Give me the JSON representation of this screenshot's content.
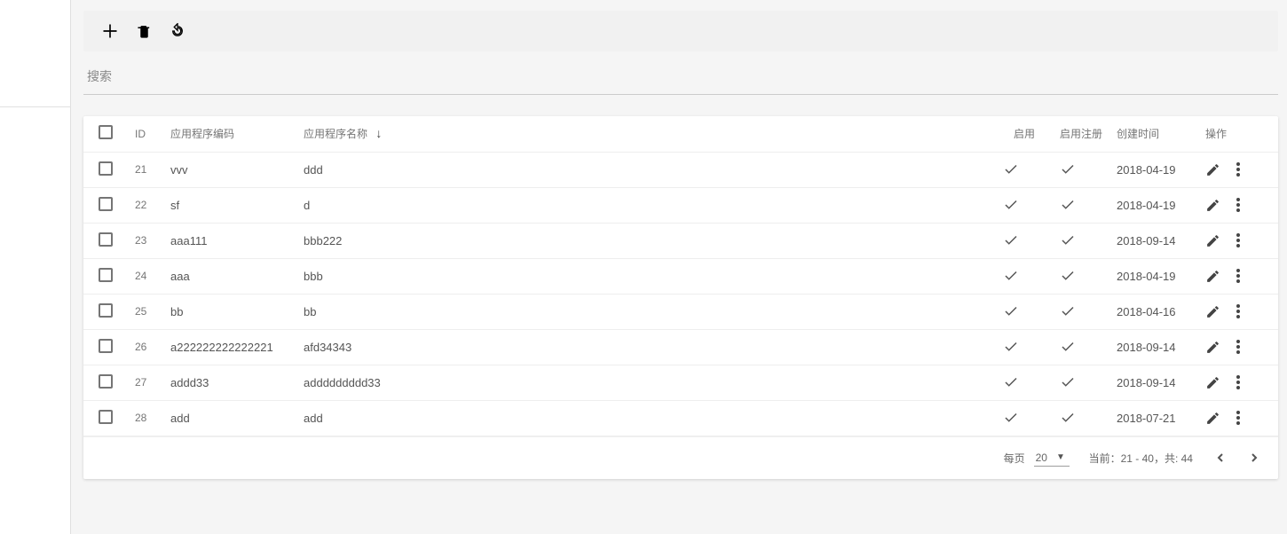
{
  "search": {
    "placeholder": "搜索"
  },
  "columns": {
    "id": "ID",
    "code": "应用程序编码",
    "name": "应用程序名称",
    "enable": "启用",
    "reg": "启用注册",
    "date": "创建时间",
    "action": "操作"
  },
  "rows": [
    {
      "id": "21",
      "code": "vvv",
      "name": "ddd",
      "enable": true,
      "reg": true,
      "date": "2018-04-19"
    },
    {
      "id": "22",
      "code": "sf",
      "name": "d",
      "enable": true,
      "reg": true,
      "date": "2018-04-19"
    },
    {
      "id": "23",
      "code": "aaa111",
      "name": "bbb222",
      "enable": true,
      "reg": true,
      "date": "2018-09-14"
    },
    {
      "id": "24",
      "code": "aaa",
      "name": "bbb",
      "enable": true,
      "reg": true,
      "date": "2018-04-19"
    },
    {
      "id": "25",
      "code": "bb",
      "name": "bb",
      "enable": true,
      "reg": true,
      "date": "2018-04-16"
    },
    {
      "id": "26",
      "code": "a222222222222221",
      "name": "afd34343",
      "enable": true,
      "reg": true,
      "date": "2018-09-14"
    },
    {
      "id": "27",
      "code": "addd33",
      "name": "addddddddd33",
      "enable": true,
      "reg": true,
      "date": "2018-09-14"
    },
    {
      "id": "28",
      "code": "add",
      "name": "add",
      "enable": true,
      "reg": true,
      "date": "2018-07-21"
    }
  ],
  "pagination": {
    "per_page_label": "每页",
    "page_size": "20",
    "range_label": "当前：21 - 40，共: 44"
  }
}
